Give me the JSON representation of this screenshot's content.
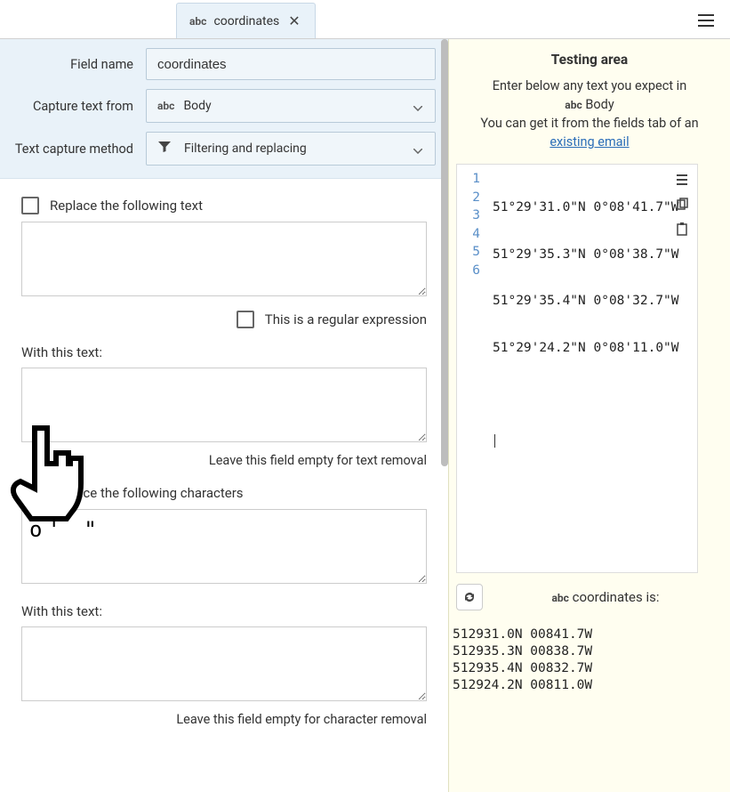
{
  "tab": {
    "abc_label": "abc",
    "title": "coordinates"
  },
  "config": {
    "field_name_label": "Field name",
    "field_name_value": "coordinates",
    "capture_from_label": "Capture text from",
    "capture_from_abc": "abc",
    "capture_from_value": "Body",
    "method_label": "Text capture method",
    "method_value": "Filtering and replacing"
  },
  "replace_text": {
    "checkbox_label": "Replace the following text",
    "checked": false,
    "value": "",
    "regex_label": "This is a regular expression",
    "regex_checked": false,
    "with_label": "With this text:",
    "with_value": "",
    "hint": "Leave this field empty for text removal"
  },
  "replace_chars": {
    "checkbox_label": "Replace the following characters",
    "checked": true,
    "value": "o' \"",
    "with_label": "With this text:",
    "with_value": "",
    "hint": "Leave this field empty for character removal"
  },
  "testing": {
    "title": "Testing area",
    "desc_line1": "Enter below any text you expect in",
    "desc_abc": "abc",
    "desc_body": "Body",
    "desc_line2": "You can get it from the fields tab of an",
    "link": "existing email",
    "lines": [
      "51°29'31.0\"N 0°08'41.7\"W",
      "51°29'35.3\"N 0°08'38.7\"W",
      "51°29'35.4\"N 0°08'32.7\"W",
      "51°29'24.2\"N 0°08'11.0\"W",
      "",
      ""
    ],
    "line_numbers": [
      "1",
      "2",
      "3",
      "4",
      "5",
      "6"
    ]
  },
  "result": {
    "abc": "abc",
    "label_suffix": "coordinates is:",
    "output": "512931.0N 00841.7W\n512935.3N 00838.7W\n512935.4N 00832.7W\n512924.2N 00811.0W"
  }
}
